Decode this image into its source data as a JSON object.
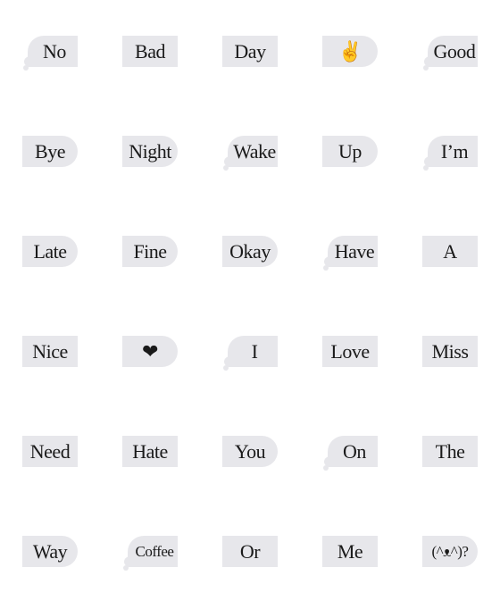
{
  "stickers": [
    {
      "text": "No",
      "shape": "left"
    },
    {
      "text": "Bad",
      "shape": "rect"
    },
    {
      "text": "Day",
      "shape": "rect"
    },
    {
      "text": "✌",
      "shape": "right"
    },
    {
      "text": "Good",
      "shape": "left"
    },
    {
      "text": "Bye",
      "shape": "right"
    },
    {
      "text": "Night",
      "shape": "right"
    },
    {
      "text": "Wake",
      "shape": "left"
    },
    {
      "text": "Up",
      "shape": "right"
    },
    {
      "text": "I’m",
      "shape": "left"
    },
    {
      "text": "Late",
      "shape": "right"
    },
    {
      "text": "Fine",
      "shape": "right"
    },
    {
      "text": "Okay",
      "shape": "right"
    },
    {
      "text": "Have",
      "shape": "left"
    },
    {
      "text": "A",
      "shape": "rect"
    },
    {
      "text": "Nice",
      "shape": "rect"
    },
    {
      "text": "❤",
      "shape": "right"
    },
    {
      "text": "I",
      "shape": "left"
    },
    {
      "text": "Love",
      "shape": "rect"
    },
    {
      "text": "Miss",
      "shape": "rect"
    },
    {
      "text": "Need",
      "shape": "rect"
    },
    {
      "text": "Hate",
      "shape": "rect"
    },
    {
      "text": "You",
      "shape": "right"
    },
    {
      "text": "On",
      "shape": "left"
    },
    {
      "text": "The",
      "shape": "rect"
    },
    {
      "text": "Way",
      "shape": "right"
    },
    {
      "text": "Coffee",
      "shape": "left"
    },
    {
      "text": "Or",
      "shape": "rect"
    },
    {
      "text": "Me",
      "shape": "rect"
    },
    {
      "text": "(^ᴥ^)?",
      "shape": "right"
    }
  ],
  "colors": {
    "bubble": "#e7e7eb",
    "text": "#1a1a1a"
  }
}
